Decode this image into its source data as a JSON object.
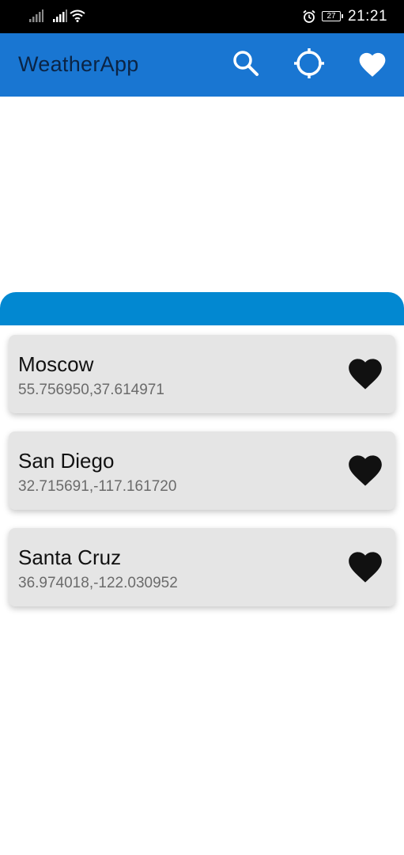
{
  "status_bar": {
    "battery": "27",
    "time": "21:21",
    "icons": [
      "signal-icon",
      "signal-icon",
      "wifi-icon",
      "alarm-icon",
      "battery-icon"
    ]
  },
  "app_bar": {
    "title": "WeatherApp",
    "actions": [
      "search-icon",
      "gps-locate-icon",
      "heart-icon"
    ],
    "color": "#1976d2"
  },
  "panel": {
    "header_color": "#0288d1"
  },
  "cities": [
    {
      "name": "Moscow",
      "coords": "55.756950,37.614971",
      "favorite_icon": "heart-icon"
    },
    {
      "name": "San Diego",
      "coords": "32.715691,-117.161720",
      "favorite_icon": "heart-icon"
    },
    {
      "name": "Santa Cruz",
      "coords": "36.974018,-122.030952",
      "favorite_icon": "heart-icon"
    }
  ]
}
